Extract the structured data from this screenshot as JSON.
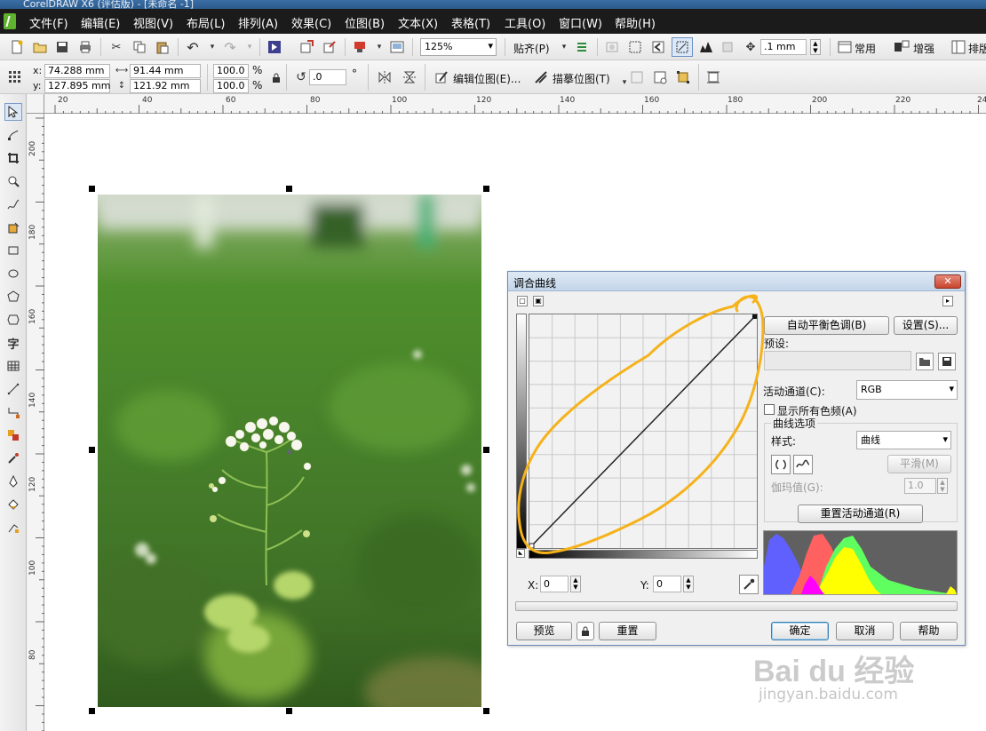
{
  "window": {
    "title": "CorelDRAW X6 (评估版) - [未命名 -1]"
  },
  "menu": [
    "文件(F)",
    "编辑(E)",
    "视图(V)",
    "布局(L)",
    "排列(A)",
    "效果(C)",
    "位图(B)",
    "文本(X)",
    "表格(T)",
    "工具(O)",
    "窗口(W)",
    "帮助(H)"
  ],
  "standard_toolbar": {
    "zoom_level": "125%",
    "snap_label": "贴齐(P)",
    "nudge_value": ".1 mm",
    "common_label": "常用",
    "enhance_label": "增强",
    "arrange_label": "排版"
  },
  "property_bar": {
    "x_label": "x:",
    "x_value": "74.288 mm",
    "y_label": "y:",
    "y_value": "127.895 mm",
    "width_value": "91.44 mm",
    "height_value": "121.92 mm",
    "scale_w": "100.0",
    "scale_h": "100.0",
    "percent": "%",
    "rotation_value": ".0",
    "degree": "°",
    "edit_bitmap_label": "编辑位图(E)...",
    "trace_bitmap_label": "描摹位图(T)"
  },
  "rulers": {
    "horizontal": [
      "20",
      "40",
      "60",
      "80",
      "100",
      "120",
      "140",
      "160",
      "180",
      "200",
      "220",
      "24"
    ],
    "vertical": [
      "200",
      "180",
      "160",
      "140",
      "120",
      "100",
      "80"
    ]
  },
  "dialog": {
    "title": "调合曲线",
    "close_label": "✕",
    "auto_balance_label": "自动平衡色调(B)",
    "settings_label": "设置(S)...",
    "preset_label": "预设:",
    "active_channel_label": "活动通道(C):",
    "active_channel_value": "RGB",
    "show_all_label": "显示所有色频(A)",
    "curve_options_label": "曲线选项",
    "style_label": "样式:",
    "style_value": "曲线",
    "smooth_label": "平滑(M)",
    "gamma_label": "伽玛值(G):",
    "gamma_value": "1.0",
    "reset_channel_label": "重置活动通道(R)",
    "x_label": "X:",
    "x_value": "0",
    "y_label": "Y:",
    "y_value": "0",
    "preview_label": "预览",
    "reset_label": "重置",
    "ok_label": "确定",
    "cancel_label": "取消",
    "help_label": "帮助"
  },
  "watermark": {
    "brand": "Bai du 经验",
    "url": "jingyan.baidu.com"
  },
  "colors": {
    "highlight": "#f5b21b",
    "menubar": "#1b1b1b"
  }
}
